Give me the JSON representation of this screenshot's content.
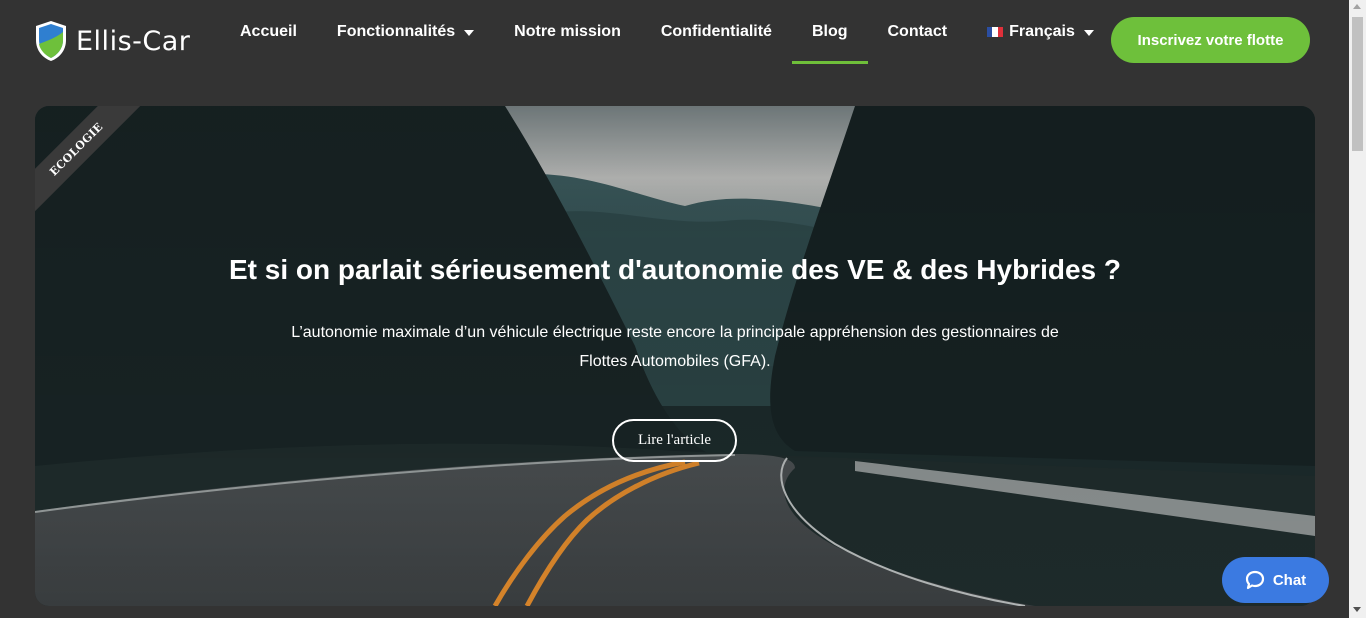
{
  "brand": {
    "name": "Ellis-Car",
    "logo_icon": "shield-logo-icon"
  },
  "nav": {
    "items": [
      {
        "label": "Accueil",
        "dropdown": false,
        "active": false
      },
      {
        "label": "Fonctionnalités",
        "dropdown": true,
        "active": false
      },
      {
        "label": "Notre mission",
        "dropdown": false,
        "active": false
      },
      {
        "label": "Confidentialité",
        "dropdown": false,
        "active": false
      },
      {
        "label": "Blog",
        "dropdown": false,
        "active": true
      },
      {
        "label": "Contact",
        "dropdown": false,
        "active": false
      }
    ],
    "language": {
      "label": "Français",
      "flag_icon": "french-flag-icon"
    }
  },
  "cta": {
    "label": "Inscrivez votre flotte"
  },
  "hero": {
    "ribbon": "ECOLOGIE",
    "title": "Et si on parlait sérieusement d'autonomie des VE & des Hybrides ?",
    "text": "L’autonomie maximale d’un véhicule électrique reste encore la principale appréhension des gestionnaires de Flottes Automobiles (GFA).",
    "button": "Lire l'article"
  },
  "chat": {
    "label": "Chat",
    "icon": "chat-bubble-icon"
  },
  "colors": {
    "background": "#333333",
    "accent_green": "#6ec03b",
    "chat_blue": "#3b7ae1"
  }
}
